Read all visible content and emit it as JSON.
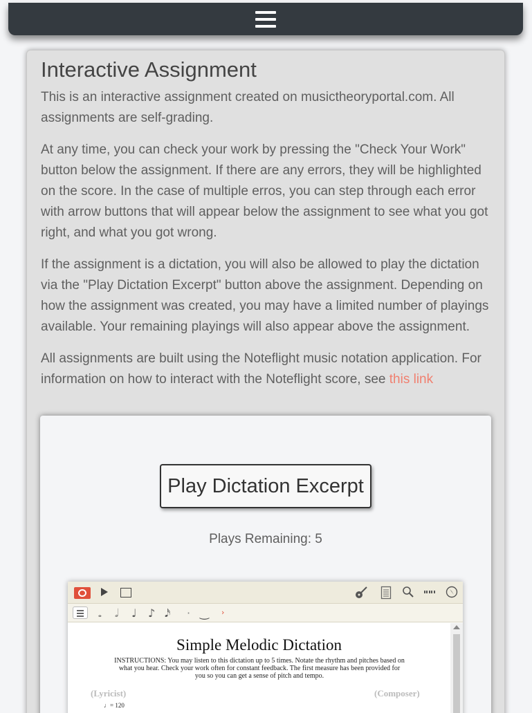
{
  "navbar": {
    "menu_icon": "hamburger-menu-icon"
  },
  "assignment": {
    "title": "Interactive Assignment",
    "paragraphs": [
      "This is an interactive assignment created on musictheoryportal.com. All assignments are self-grading.",
      "At any time, you can check your work by pressing the \"Check Your Work\" button below the assignment. If there are any errors, they will be highlighted on the score. In the case of multiple erros, you can step through each error with arrow buttons that will appear below the assignment to see what you got right, and what you got wrong.",
      "If the assignment is a dictation, you will also be allowed to play the dictation via the \"Play Dictation Excerpt\" button above the assignment. Depending on how the assignment was created, you may have a limited number of playings available. Your remaining playings will also appear above the assignment."
    ],
    "last_paragraph": "All assignments are built using the Noteflight music notation application. For information on how to interact with the Noteflight score, see ",
    "link_text": "this link",
    "link_color": "#f08070"
  },
  "dictation": {
    "play_button": "Play Dictation Excerpt",
    "plays_remaining": "Plays Remaining: 5"
  },
  "noteflight": {
    "toolbar_icons": [
      "noteflight-logo-icon",
      "play-icon",
      "stop-icon",
      "guitar-icon",
      "document-icon",
      "zoom-icon",
      "keyboard-icon",
      "compass-icon"
    ],
    "palette": [
      "menu-icon",
      "whole-note-icon",
      "half-note-icon",
      "quarter-note-icon",
      "eighth-note-icon",
      "sixteenth-note-icon",
      "dot-icon",
      "tie-icon",
      "more-icon"
    ],
    "score": {
      "title": "Simple Melodic Dictation",
      "instructions": "INSTRUCTIONS: You may listen to this dictation up to 5 times. Notate the rhythm and pitches based on what you hear. Check your work often for constant feedback. The first measure has been provided for you so you can get a sense of pitch and tempo.",
      "lyricist": "(Lyricist)",
      "composer": "(Composer)",
      "tempo": "♩= 120"
    }
  }
}
